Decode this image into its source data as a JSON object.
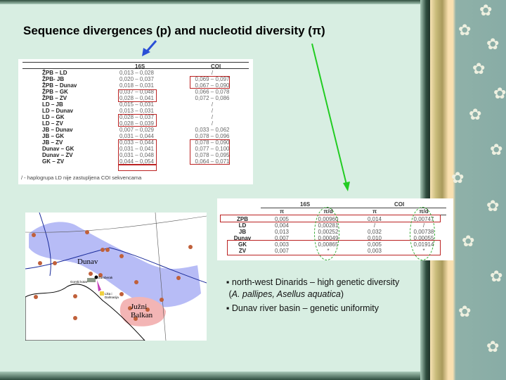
{
  "title": "Sequence divergences (p) and nucleotid diversity (π)",
  "table1": {
    "headers": {
      "col1": "16S",
      "col2": "COI"
    },
    "rows": [
      {
        "pair": "ŽPB – LD",
        "s16": "0,013 – 0,028",
        "coi": "/"
      },
      {
        "pair": "ŽPB- JB",
        "s16": "0,020 – 0,037",
        "coi": "0,069 – 0,097"
      },
      {
        "pair": "ŽPB – Dunav",
        "s16": "0,018 – 0,031",
        "coi": "0,067 – 0,090"
      },
      {
        "pair": "ŽPB – GK",
        "s16": "0,037 – 0,048",
        "coi": "0,066 – 0,078"
      },
      {
        "pair": "ŽPB – ZV",
        "s16": "0,028 – 0,041",
        "coi": "0,072 – 0,086"
      },
      {
        "pair": "LD – JB",
        "s16": "0,015 – 0,031",
        "coi": "/"
      },
      {
        "pair": "LD – Dunav",
        "s16": "0,013 – 0,031",
        "coi": "/"
      },
      {
        "pair": "LD – GK",
        "s16": "0,028 – 0,037",
        "coi": "/"
      },
      {
        "pair": "LD – ZV",
        "s16": "0,028 – 0,039",
        "coi": "/"
      },
      {
        "pair": "JB – Dunav",
        "s16": "0,007 – 0,029",
        "coi": "0,033 – 0,062"
      },
      {
        "pair": "JB – GK",
        "s16": "0,031 – 0,044",
        "coi": "0,078 – 0,096"
      },
      {
        "pair": "JB – ZV",
        "s16": "0,033 – 0,044",
        "coi": "0,078 – 0,090"
      },
      {
        "pair": "Dunav – GK",
        "s16": "0,031 – 0,041",
        "coi": "0,077 – 0,100"
      },
      {
        "pair": "Dunav – ZV",
        "s16": "0,031 – 0,048",
        "coi": "0,078 – 0,095"
      },
      {
        "pair": "GK – ZV",
        "s16": "0,044 – 0,054",
        "coi": "0,064 – 0,071"
      }
    ],
    "note": "/ - haplogrupa LD nije zastupljena COI sekvencama"
  },
  "table2": {
    "group_headers": [
      "16S",
      "COI"
    ],
    "sub_headers": [
      "π",
      "π/d",
      "π",
      "π/d"
    ],
    "rows": [
      {
        "name": "ZPB",
        "a": "0,005",
        "b": "0,00960",
        "c": "0,014",
        "d": "0,00747"
      },
      {
        "name": "LD",
        "a": "0,004",
        "b": "0,00281",
        "c": "/",
        "d": "/"
      },
      {
        "name": "JB",
        "a": "0,013",
        "b": "0,00252",
        "c": "0,032",
        "d": "0,00738"
      },
      {
        "name": "Dunav",
        "a": "0,007",
        "b": "0,00049",
        "c": "0,010",
        "d": "0,00055"
      },
      {
        "name": "GK",
        "a": "0,003",
        "b": "0,00865",
        "c": "0,005",
        "d": "0,01914"
      },
      {
        "name": "ZV",
        "a": "0,007",
        "b": "*",
        "c": "0,003",
        "d": "*"
      }
    ]
  },
  "map": {
    "labels": {
      "dunav": "Dunav",
      "south": "Južni Balkan",
      "gk": "Gorski kotar",
      "ld": "Lika i Dalmacija",
      "zpb": "Žumberak"
    }
  },
  "bullets": [
    {
      "text": "north-west Dinarids – high genetic diversity",
      "species": "A. pallipes, Asellus aquatica"
    },
    {
      "text": "Dunav river basin – genetic uniformity"
    }
  ]
}
